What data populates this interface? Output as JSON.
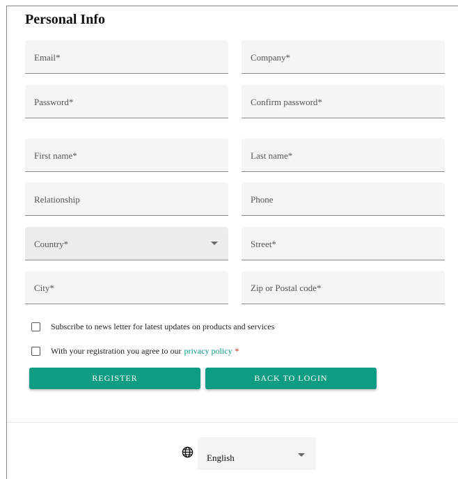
{
  "form": {
    "title": "Personal Info",
    "fields": {
      "email": "Email*",
      "company": "Company*",
      "password": "Password*",
      "confirm_password": "Confirm password*",
      "first_name": "First name*",
      "last_name": "Last name*",
      "relationship": "Relationship",
      "phone": "Phone",
      "country": "Country*",
      "street": "Street*",
      "city": "City*",
      "zip": "Zip or Postal code*"
    },
    "checkboxes": {
      "newsletter": {
        "text": "Subscribe to news letter for latest updates on products and services",
        "checked": false
      },
      "privacy": {
        "text": "With your registration you agree to our",
        "link": "privacy policy",
        "required_mark": "*",
        "checked": false
      }
    },
    "buttons": {
      "register": "REGISTER",
      "back_to_login": "BACK TO LOGIN"
    }
  },
  "footer": {
    "language": {
      "icon": "globe-icon",
      "selected": "English"
    }
  },
  "colors": {
    "accent": "#0e9c82",
    "link": "#0a9a85",
    "required": "#e02020",
    "field_bg": "#f5f5f5"
  }
}
